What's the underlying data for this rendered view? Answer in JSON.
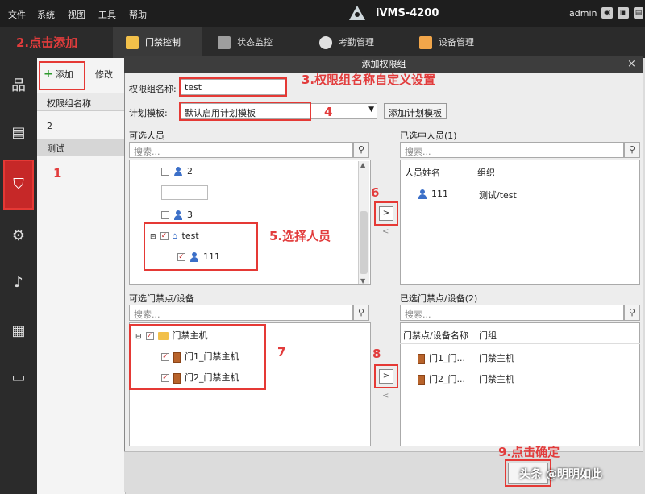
{
  "menubar": {
    "items": [
      "文件",
      "系统",
      "视图",
      "工具",
      "帮助"
    ],
    "app_title": "iVMS-4200",
    "user": "admin"
  },
  "tabs": [
    "门禁控制",
    "状态监控",
    "考勤管理",
    "设备管理"
  ],
  "sidepanel": {
    "add_label": "添加",
    "edit_label": "修改",
    "column_header": "权限组名称",
    "rows": [
      "2",
      "测试"
    ]
  },
  "dialog": {
    "title": "添加权限组",
    "name_label": "权限组名称:",
    "name_value": "test",
    "schedule_label": "计划模板:",
    "schedule_value": "默认启用计划模板",
    "add_schedule_button": "添加计划模板",
    "available_persons_label": "可选人员",
    "selected_persons_label": "已选中人员(1)",
    "search_placeholder": "搜索...",
    "person_tree": [
      {
        "label": "2",
        "checked": false,
        "type": "person"
      },
      {
        "label": "3",
        "checked": false,
        "type": "person"
      },
      {
        "label": "test",
        "checked": true,
        "type": "group"
      },
      {
        "label": "111",
        "checked": true,
        "type": "person"
      }
    ],
    "selected_person_columns": [
      "人员姓名",
      "组织"
    ],
    "selected_persons": [
      {
        "name": "111",
        "org": "测试/test"
      }
    ],
    "available_doors_label": "可选门禁点/设备",
    "selected_doors_label": "已选门禁点/设备(2)",
    "door_tree": [
      {
        "label": "门禁主机",
        "checked": true,
        "type": "folder"
      },
      {
        "label": "门1_门禁主机",
        "checked": true,
        "type": "door"
      },
      {
        "label": "门2_门禁主机",
        "checked": true,
        "type": "door"
      }
    ],
    "selected_door_columns": [
      "门禁点/设备名称",
      "门组"
    ],
    "selected_doors": [
      {
        "name": "门1_门...",
        "group": "门禁主机"
      },
      {
        "name": "门2_门...",
        "group": "门禁主机"
      }
    ],
    "move_right": ">",
    "move_left": "<"
  },
  "annotations": {
    "a1": "1",
    "a2": "2.点击添加",
    "a3": "3.权限组名称自定义设置",
    "a4": "4",
    "a5": "5.选择人员",
    "a6": "6",
    "a7": "7",
    "a8": "8",
    "a9": "9.点击确定"
  },
  "watermark": "头条 @明明如此",
  "colors": {
    "annotation_red": "#e53935",
    "dark_bar": "#1e1e1e",
    "accent_red_nav": "#c62828"
  }
}
